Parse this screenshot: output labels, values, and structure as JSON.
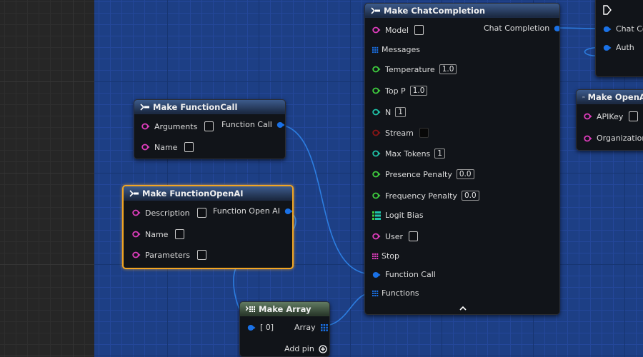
{
  "nodes": {
    "function_call": {
      "title": "Make FunctionCall",
      "pins": {
        "arguments": "Arguments",
        "name": "Name",
        "output": "Function Call"
      }
    },
    "function_openai": {
      "title": "Make FunctionOpenAI",
      "pins": {
        "description": "Description",
        "name": "Name",
        "parameters": "Parameters",
        "output": "Function Open AI"
      }
    },
    "make_array": {
      "title": "Make Array",
      "pins": {
        "index0": "[ 0]",
        "output": "Array",
        "add_pin": "Add pin"
      }
    },
    "chat_completion": {
      "title": "Make ChatCompletion",
      "pins": {
        "model": "Model",
        "output": "Chat Completion",
        "messages": "Messages",
        "temperature": "Temperature",
        "temperature_value": "1.0",
        "top_p": "Top P",
        "top_p_value": "1.0",
        "n": "N",
        "n_value": "1",
        "stream": "Stream",
        "max_tokens": "Max Tokens",
        "max_tokens_value": "1",
        "presence_penalty": "Presence Penalty",
        "presence_penalty_value": "0.0",
        "frequency_penalty": "Frequency Penalty",
        "frequency_penalty_value": "0.0",
        "logit_bias": "Logit Bias",
        "user": "User",
        "stop": "Stop",
        "function_call": "Function Call",
        "functions": "Functions"
      }
    },
    "right_top": {
      "pins": {
        "chat": "Chat Cor",
        "auth": "Auth"
      }
    },
    "openai_auth": {
      "title": "Make OpenAIA",
      "pins": {
        "api_key": "APIKey",
        "organization": "Organization I"
      }
    }
  },
  "colors": {
    "string_pin": "#e03dbd",
    "struct_pin": "#1a71e6",
    "float_pin": "#3fcf3f",
    "int_pin": "#1fc3a8",
    "bool_pin": "#8a1515",
    "array_pin": "#1a71e6",
    "selection": "#f3a623",
    "wire": "#2c7de0"
  }
}
